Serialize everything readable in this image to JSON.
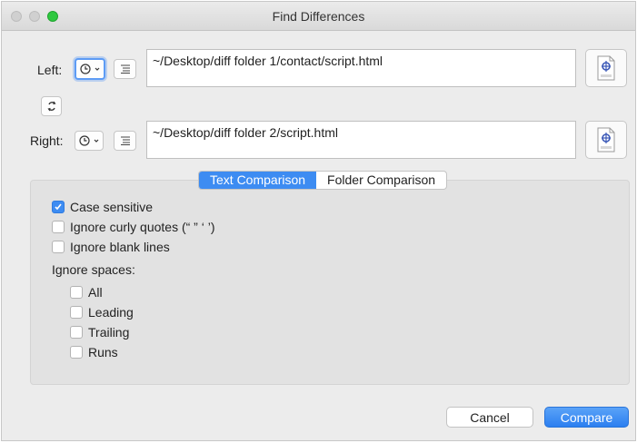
{
  "window": {
    "title": "Find Differences"
  },
  "left": {
    "label": "Left:",
    "path": "~/Desktop/diff folder 1/contact/script.html",
    "recent_icon": "clock-icon",
    "list_icon": "list-icon",
    "doc_icon": "text-document-icon"
  },
  "swap": {
    "icon": "swap-arrows-icon"
  },
  "right": {
    "label": "Right:",
    "path": "~/Desktop/diff folder 2/script.html",
    "recent_icon": "clock-icon",
    "list_icon": "list-icon",
    "doc_icon": "text-document-icon"
  },
  "tabs": [
    {
      "label": "Text Comparison",
      "selected": true
    },
    {
      "label": "Folder Comparison",
      "selected": false
    }
  ],
  "options": {
    "case_sensitive": {
      "label": "Case sensitive",
      "checked": true
    },
    "ignore_curly_quotes": {
      "label": "Ignore curly quotes (“ ” ‘ ’)",
      "checked": false
    },
    "ignore_blank_lines": {
      "label": "Ignore blank lines",
      "checked": false
    },
    "ignore_spaces_label": "Ignore spaces:",
    "spaces": [
      {
        "label": "All",
        "checked": false
      },
      {
        "label": "Leading",
        "checked": false
      },
      {
        "label": "Trailing",
        "checked": false
      },
      {
        "label": "Runs",
        "checked": false
      }
    ]
  },
  "buttons": {
    "cancel": "Cancel",
    "compare": "Compare"
  },
  "colors": {
    "accent": "#3d8cf2",
    "green_light": "#2fc840"
  }
}
